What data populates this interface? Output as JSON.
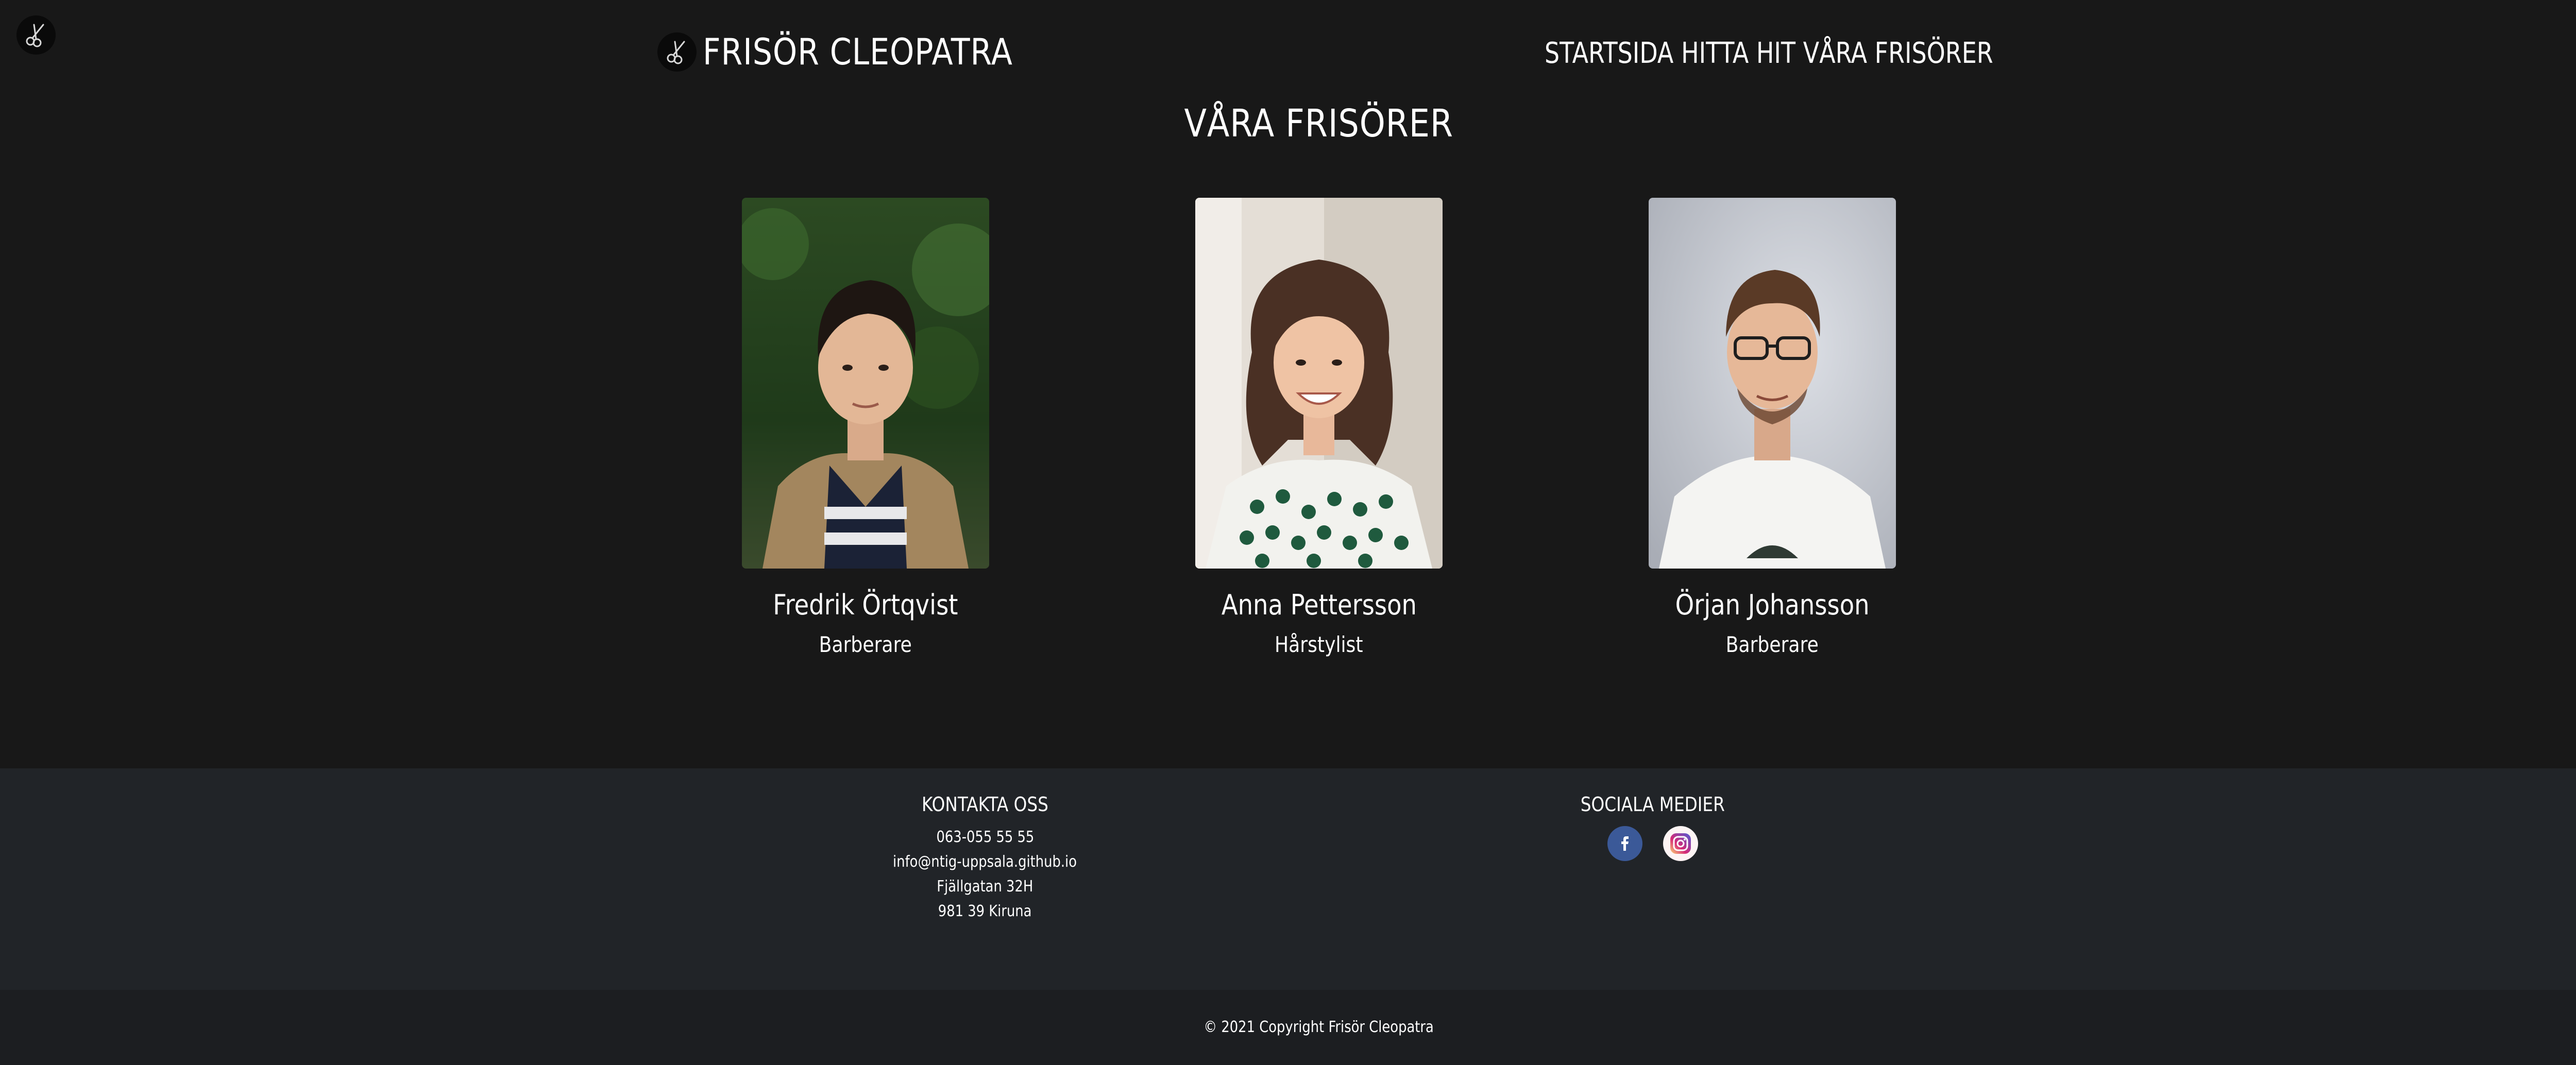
{
  "header": {
    "brand_name": "FRISÖR CLEOPATRA",
    "logo_icon": "scissors-icon",
    "nav": [
      {
        "label": "STARTSIDA"
      },
      {
        "label": "HITTA HIT"
      },
      {
        "label": "VÅRA FRISÖRER"
      }
    ]
  },
  "main": {
    "title": "VÅRA FRISÖRER",
    "staff": [
      {
        "name": "Fredrik Örtqvist",
        "role": "Barberare"
      },
      {
        "name": "Anna Pettersson",
        "role": "Hårstylist"
      },
      {
        "name": "Örjan Johansson",
        "role": "Barberare"
      }
    ]
  },
  "footer": {
    "contact": {
      "heading": "KONTAKTA OSS",
      "phone": "063-055 55 55",
      "email": "info@ntig-uppsala.github.io",
      "street": "Fjällgatan 32H",
      "city": "981 39 Kiruna"
    },
    "social": {
      "heading": "SOCIALA MEDIER",
      "icons": [
        "facebook-icon",
        "instagram-icon"
      ]
    },
    "copyright": "© 2021 Copyright Frisör Cleopatra"
  },
  "colors": {
    "background": "#181818",
    "footer": "#212428",
    "copyright_bar": "#1c1e21",
    "facebook": "#3b5998",
    "text": "#ffffff"
  }
}
